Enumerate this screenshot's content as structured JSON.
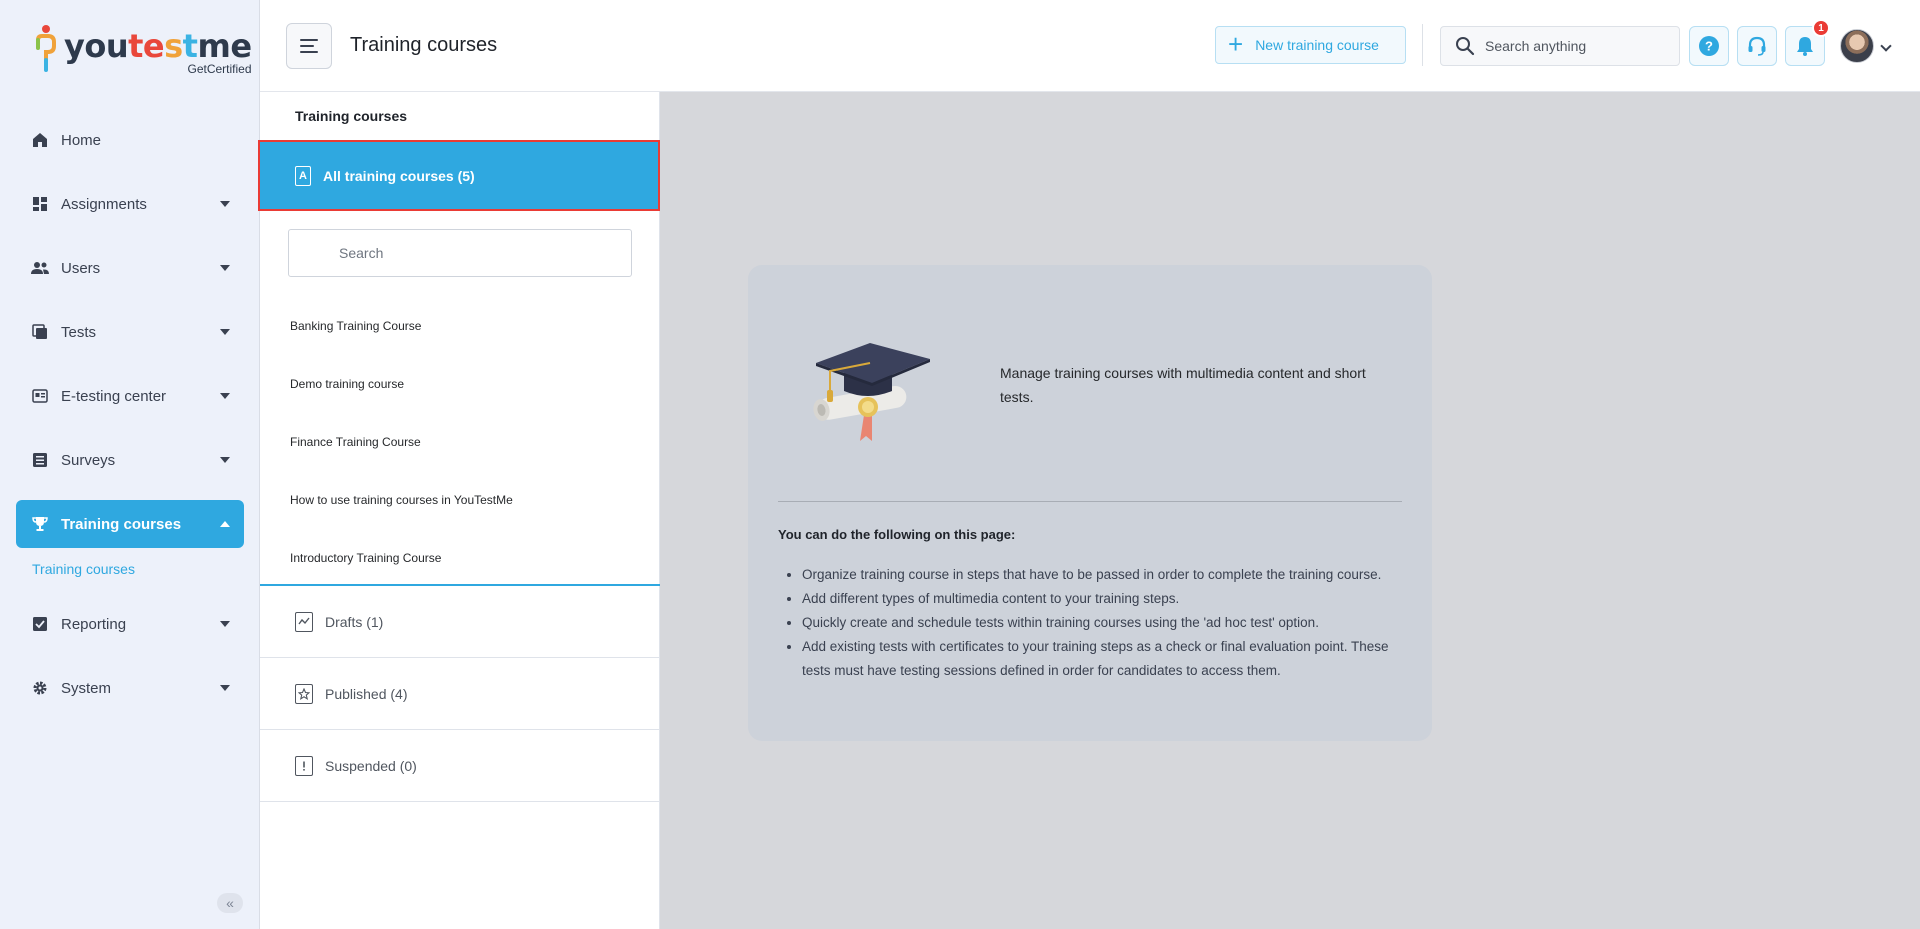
{
  "app": {
    "logo_main": "youtestme",
    "logo_sub": "GetCertified"
  },
  "sidebar": {
    "items": [
      {
        "label": "Home",
        "icon": "home-icon",
        "expandable": false
      },
      {
        "label": "Assignments",
        "icon": "dashboard-icon",
        "expandable": true
      },
      {
        "label": "Users",
        "icon": "users-icon",
        "expandable": true
      },
      {
        "label": "Tests",
        "icon": "tests-icon",
        "expandable": true
      },
      {
        "label": "E-testing center",
        "icon": "testing-center-icon",
        "expandable": true
      },
      {
        "label": "Surveys",
        "icon": "surveys-icon",
        "expandable": true
      },
      {
        "label": "Training courses",
        "icon": "trophy-icon",
        "expandable": true,
        "active": true
      },
      {
        "label": "Reporting",
        "icon": "reporting-icon",
        "expandable": true
      },
      {
        "label": "System",
        "icon": "gear-icon",
        "expandable": true
      }
    ],
    "subitem": "Training courses",
    "collapse_label": "«"
  },
  "header": {
    "title": "Training courses",
    "new_button": "New training course",
    "search_placeholder": "Search anything",
    "notification_count": "1"
  },
  "left_panel": {
    "title": "Training courses",
    "all_courses": "All training courses (5)",
    "all_courses_icon_letter": "A",
    "search_placeholder": "Search",
    "courses": [
      "Banking Training Course",
      "Demo training course",
      "Finance Training Course",
      "How to use training courses in YouTestMe",
      "Introductory Training Course"
    ],
    "statuses": [
      {
        "label": "Drafts (1)",
        "icon": "drafts-icon"
      },
      {
        "label": "Published (4)",
        "icon": "published-icon"
      },
      {
        "label": "Suspended (0)",
        "icon": "suspended-icon"
      }
    ]
  },
  "info_card": {
    "description": "Manage training courses with multimedia content and short tests.",
    "subtitle": "You can do the following on this page:",
    "bullets": [
      "Organize training course in steps that have to be passed in order to complete the training course.",
      "Add different types of multimedia content to your training steps.",
      "Quickly create and schedule tests within training courses using the 'ad hoc test' option.",
      "Add existing tests with certificates to your training steps as a check or final evaluation point. These tests must have testing sessions defined in order for candidates to access them."
    ]
  },
  "colors": {
    "accent": "#2fa8e0",
    "highlight_border": "#ea3b35",
    "badge": "#ea3b35"
  }
}
